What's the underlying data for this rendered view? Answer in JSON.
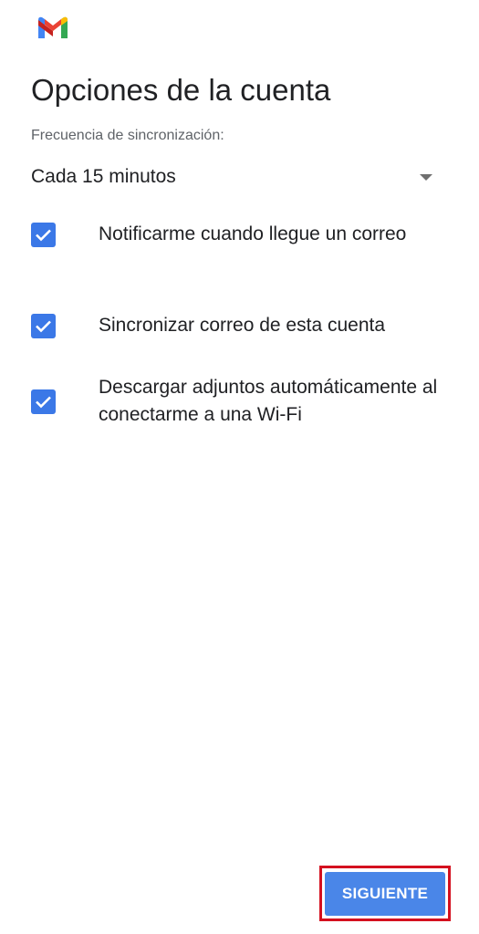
{
  "app": {
    "logo_icon": "gmail-logo-icon"
  },
  "header": {
    "title": "Opciones de la cuenta"
  },
  "sync": {
    "label": "Frecuencia de sincronización:",
    "selected": "Cada 15 minutos",
    "icon": "dropdown-arrow-icon"
  },
  "options": [
    {
      "label": "Notificarme cuando llegue un correo",
      "checked": true
    },
    {
      "label": "Sincronizar correo de esta cuenta",
      "checked": true
    },
    {
      "label": "Descargar adjuntos automáticamente al conectarme a una Wi-Fi",
      "checked": true
    }
  ],
  "footer": {
    "next_label": "SIGUIENTE"
  },
  "colors": {
    "accent": "#4a86e8",
    "checkbox": "#3b78e7",
    "highlight_border": "#d4101f"
  }
}
